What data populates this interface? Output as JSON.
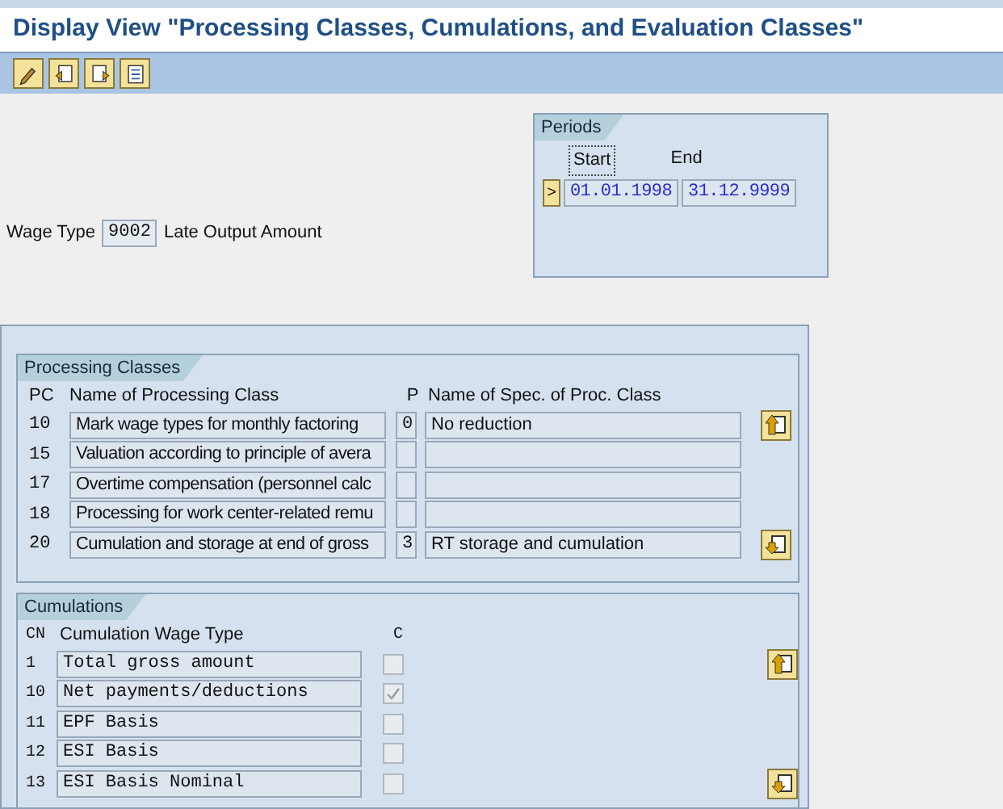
{
  "title": "Display View \"Processing Classes, Cumulations, and Evaluation Classes\"",
  "toolbar": [
    {
      "kind": "pencil"
    },
    {
      "kind": "prev"
    },
    {
      "kind": "next"
    },
    {
      "kind": "table"
    }
  ],
  "wage_type": {
    "label": "Wage Type",
    "value": "9002",
    "description": "Late Output Amount"
  },
  "periods": {
    "title": "Periods",
    "start_label": "Start",
    "end_label": "End",
    "nav": ">",
    "start": "01.01.1998",
    "end": "31.12.9999"
  },
  "processing_classes": {
    "title": "Processing Classes",
    "columns": [
      "PC",
      "Name of Processing Class",
      "P",
      "Name of Spec. of Proc. Class"
    ],
    "rows": [
      {
        "pc": "10",
        "name": "Mark wage types for monthly factoring",
        "p": "0",
        "spec": "No reduction"
      },
      {
        "pc": "15",
        "name": "Valuation according to principle of avera"
      },
      {
        "pc": "17",
        "name": "Overtime compensation (personnel calc"
      },
      {
        "pc": "18",
        "name": "Processing for work center-related remu"
      },
      {
        "pc": "20",
        "name": "Cumulation and storage at end of gross",
        "p": "3",
        "spec": "RT storage and cumulation"
      }
    ]
  },
  "cumulations": {
    "title": "Cumulations",
    "columns": [
      "CN",
      "Cumulation Wage Type",
      "C"
    ],
    "rows": [
      {
        "cn": "1",
        "name": "Total gross amount",
        "checked": false
      },
      {
        "cn": "10",
        "name": "Net payments/deductions",
        "checked": true
      },
      {
        "cn": "11",
        "name": "EPF Basis",
        "checked": false
      },
      {
        "cn": "12",
        "name": "ESI Basis",
        "checked": false
      },
      {
        "cn": "13",
        "name": "ESI Basis Nominal",
        "checked": false
      }
    ]
  }
}
